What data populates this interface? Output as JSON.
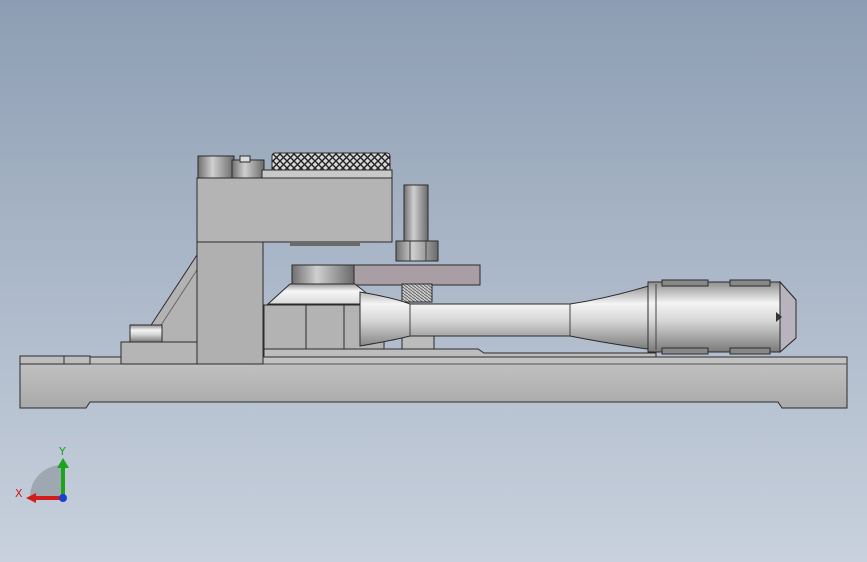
{
  "triad": {
    "x_label": "X",
    "y_label": "Y",
    "colors": {
      "x": "#d21c1c",
      "y": "#1ca51c",
      "z": "#1c3fd2"
    }
  },
  "model": {
    "body_color": "#b7b7b7",
    "edge_color": "#2b2b2b",
    "clamp_plate_color": "#a89ea3"
  }
}
